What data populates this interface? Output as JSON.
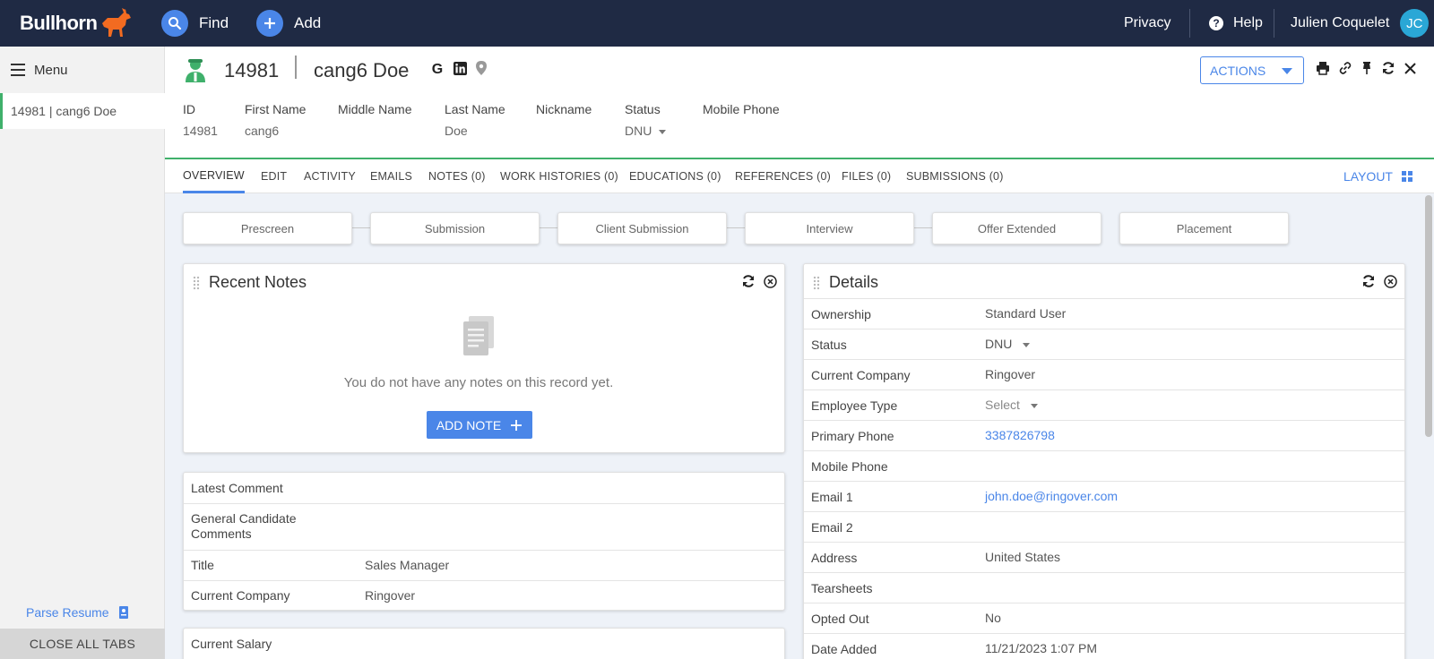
{
  "brand": {
    "name": "Bullhorn",
    "accent": "#f26b21"
  },
  "topbar": {
    "find_label": "Find",
    "add_label": "Add",
    "privacy_label": "Privacy",
    "help_label": "Help",
    "user_name": "Julien Coquelet",
    "user_initials": "JC"
  },
  "sidebar": {
    "menu_label": "Menu",
    "open_tab": "14981 | cang6 Doe",
    "parse_resume": "Parse Resume",
    "close_all_tabs": "CLOSE ALL TABS"
  },
  "record": {
    "id": "14981",
    "name": "cang6 Doe",
    "actions_label": "ACTIONS",
    "fields": [
      {
        "label": "ID",
        "value": "14981"
      },
      {
        "label": "First Name",
        "value": "cang6"
      },
      {
        "label": "Middle Name",
        "value": ""
      },
      {
        "label": "Last Name",
        "value": "Doe"
      },
      {
        "label": "Nickname",
        "value": ""
      },
      {
        "label": "Status",
        "value": "DNU"
      },
      {
        "label": "Mobile Phone",
        "value": ""
      }
    ]
  },
  "tabs": [
    "OVERVIEW",
    "EDIT",
    "ACTIVITY",
    "EMAILS",
    "NOTES (0)",
    "WORK HISTORIES (0)",
    "EDUCATIONS (0)",
    "REFERENCES (0)",
    "FILES (0)",
    "SUBMISSIONS (0)"
  ],
  "layout_label": "LAYOUT",
  "pipeline": [
    "Prescreen",
    "Submission",
    "Client Submission",
    "Interview",
    "Offer Extended",
    "Placement"
  ],
  "recent_notes": {
    "title": "Recent Notes",
    "empty_text": "You do not have any notes on this record yet.",
    "add_note_label": "ADD NOTE"
  },
  "summary_card": {
    "rows": [
      {
        "label": "Latest Comment",
        "value": ""
      },
      {
        "label": "General Candidate Comments",
        "value": ""
      },
      {
        "label": "Title",
        "value": "Sales Manager"
      },
      {
        "label": "Current Company",
        "value": "Ringover"
      }
    ]
  },
  "salary_card": {
    "label": "Current Salary"
  },
  "details": {
    "title": "Details",
    "rows": [
      {
        "label": "Ownership",
        "value": "Standard User"
      },
      {
        "label": "Status",
        "value": "DNU"
      },
      {
        "label": "Current Company",
        "value": "Ringover"
      },
      {
        "label": "Employee Type",
        "value": "Select"
      },
      {
        "label": "Primary Phone",
        "value": "3387826798"
      },
      {
        "label": "Mobile Phone",
        "value": ""
      },
      {
        "label": "Email 1",
        "value": "john.doe@ringover.com"
      },
      {
        "label": "Email 2",
        "value": ""
      },
      {
        "label": "Address",
        "value": "United States"
      },
      {
        "label": "Tearsheets",
        "value": ""
      },
      {
        "label": "Opted Out",
        "value": "No"
      },
      {
        "label": "Date Added",
        "value": "11/21/2023 1:07 PM"
      }
    ]
  }
}
